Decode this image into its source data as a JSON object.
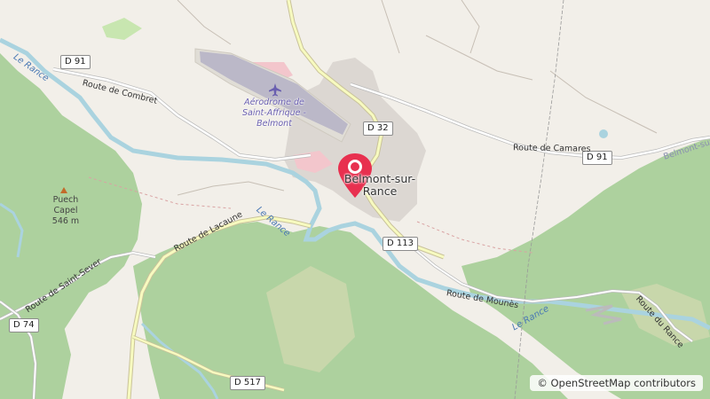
{
  "map": {
    "roads": {
      "d91_west": "D 91",
      "d91_east": "D 91",
      "d32": "D 32",
      "d113": "D 113",
      "d74": "D 74",
      "d517": "D 517",
      "route_combret": "Route de Combret",
      "route_camares": "Route de Camares",
      "route_lacaune": "Route de Lacaune",
      "route_saint_sever": "Route de Saint-Sever",
      "route_mounes": "Route de Mounès",
      "route_du_rance": "Route du Rance",
      "belmont_edge": "Belmont-sur-R"
    },
    "rivers": {
      "top_left": "Le Rance",
      "center": "Le Rance",
      "lower": "Le Rance"
    },
    "places": {
      "town": "Belmont-sur-Rance",
      "aerodrome": "Aérodrome de Saint-Affrique - Belmont",
      "peak_name": "Puech Capel",
      "peak_elevation": "546 m"
    },
    "icons": {
      "location_marker": "map-pin-icon",
      "airport": "airplane-icon",
      "peak": "triangle-peak-icon"
    },
    "colors": {
      "forest": "#add19e",
      "marker": "#e8304f",
      "water": "#aad3df",
      "road_major": "#f7fabf",
      "airport_area": "#e9e7e2"
    }
  },
  "attribution": "© OpenStreetMap contributors"
}
